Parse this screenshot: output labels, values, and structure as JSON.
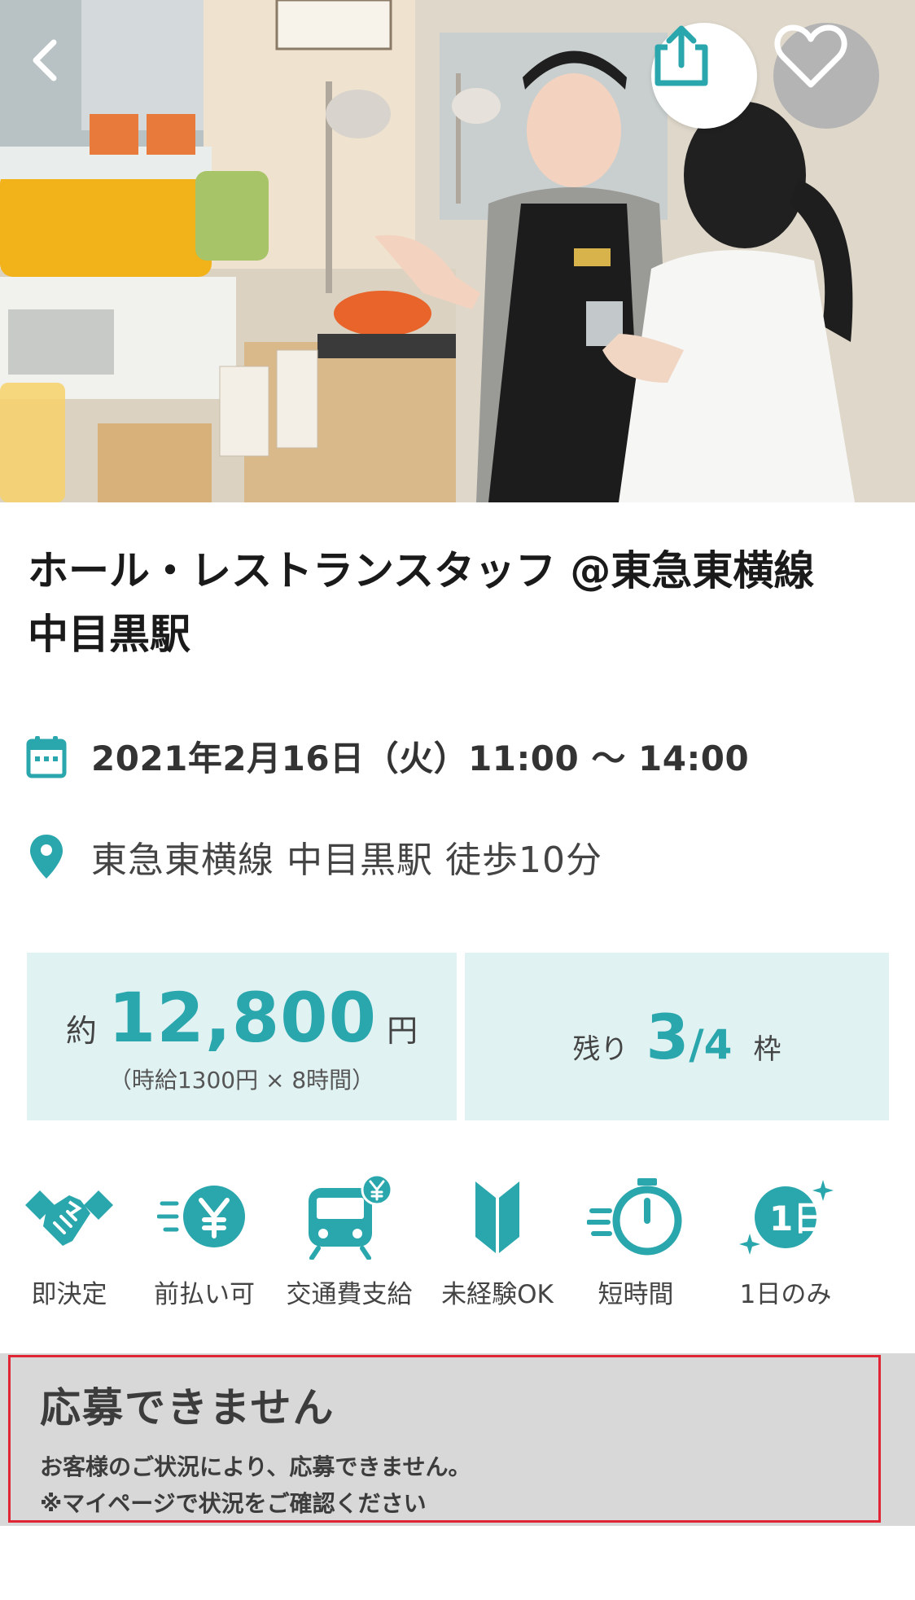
{
  "header": {
    "back_icon": "chevron-left-icon",
    "share_icon": "share-icon",
    "favorite_icon": "heart-icon",
    "hero_alt": "restaurant-staff-photo"
  },
  "job": {
    "title_line1": "ホール・レストランスタッフ @東急東横線",
    "title_line2": "中目黒駅",
    "date": "2021年2月16日（火）11:00 〜 14:00",
    "location": "東急東横線 中目黒駅 徒歩10分"
  },
  "wage": {
    "prefix": "約",
    "amount": "12,800",
    "unit": "円",
    "detail": "（時給1300円 × 8時間）"
  },
  "slots": {
    "label": "残り",
    "remaining": "3",
    "total": "/4",
    "unit": "枠"
  },
  "features": [
    {
      "label": "即決定",
      "icon": "handshake-icon"
    },
    {
      "label": "前払い可",
      "icon": "yen-coin-icon"
    },
    {
      "label": "交通費支給",
      "icon": "train-yen-icon"
    },
    {
      "label": "未経験OK",
      "icon": "beginner-mark-icon"
    },
    {
      "label": "短時間",
      "icon": "stopwatch-icon"
    },
    {
      "label": "1日のみ",
      "icon": "one-day-icon",
      "badge": "1日"
    }
  ],
  "notice": {
    "title": "応募できません",
    "line1": "お客様のご状況により、応募できません。",
    "line2": "※マイページで状況をご確認ください"
  },
  "colors": {
    "accent": "#2aa6ad",
    "box_bg": "#e1f2f3",
    "notice_bg": "#d8d8d8",
    "notice_border": "#e02634"
  }
}
